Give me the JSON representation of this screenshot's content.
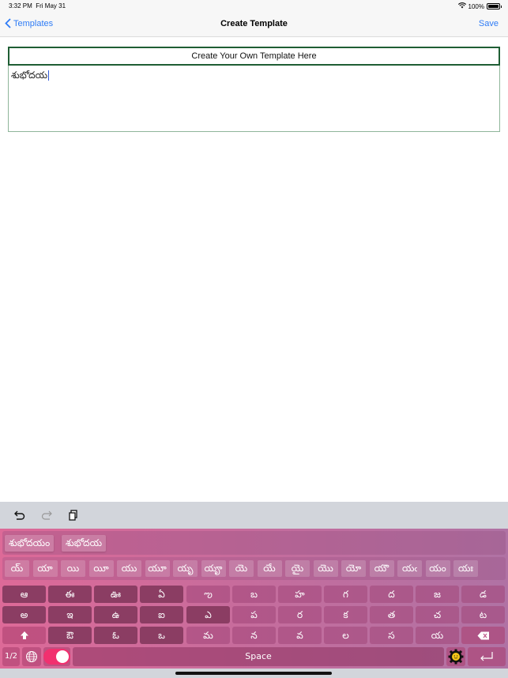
{
  "status": {
    "time": "3:32 PM",
    "date": "Fri May 31",
    "battery": "100%"
  },
  "nav": {
    "back_label": "Templates",
    "title": "Create Template",
    "save_label": "Save"
  },
  "template": {
    "header": "Create Your Own Template Here",
    "text": "శుభోదయ"
  },
  "toolbar": {
    "undo": "undo-icon",
    "redo": "redo-icon",
    "paste": "paste-icon"
  },
  "keyboard": {
    "word_suggestions": [
      "శుభోదయం",
      "శుభోదయ"
    ],
    "vowel_sign_suggestions": [
      "య్",
      "యా",
      "యి",
      "యీ",
      "యు",
      "యూ",
      "యృ",
      "యౄ",
      "యె",
      "యే",
      "యై",
      "యొ",
      "యో",
      "యౌ",
      "యఁ",
      "యం",
      "యః"
    ],
    "row1": [
      "ఆ",
      "ఈ",
      "ఊ",
      "ఏ",
      "ఌ",
      "బ",
      "హ",
      "గ",
      "ద",
      "జ",
      "డ"
    ],
    "row2": [
      "అ",
      "ఇ",
      "ఉ",
      "ఐ",
      "ఎ",
      "ప",
      "ర",
      "క",
      "త",
      "చ",
      "ట"
    ],
    "row3": [
      "ఔ",
      "ఓ",
      "ఒ",
      "మ",
      "న",
      "వ",
      "ల",
      "స",
      "య"
    ],
    "page_label": "1/2",
    "space_label": "Space",
    "toggle_on": true,
    "colors": {
      "accent": "#f1306f",
      "key_dark": "#8b3d63",
      "background_start": "#dd6a98",
      "background_end": "#b072a4"
    }
  }
}
